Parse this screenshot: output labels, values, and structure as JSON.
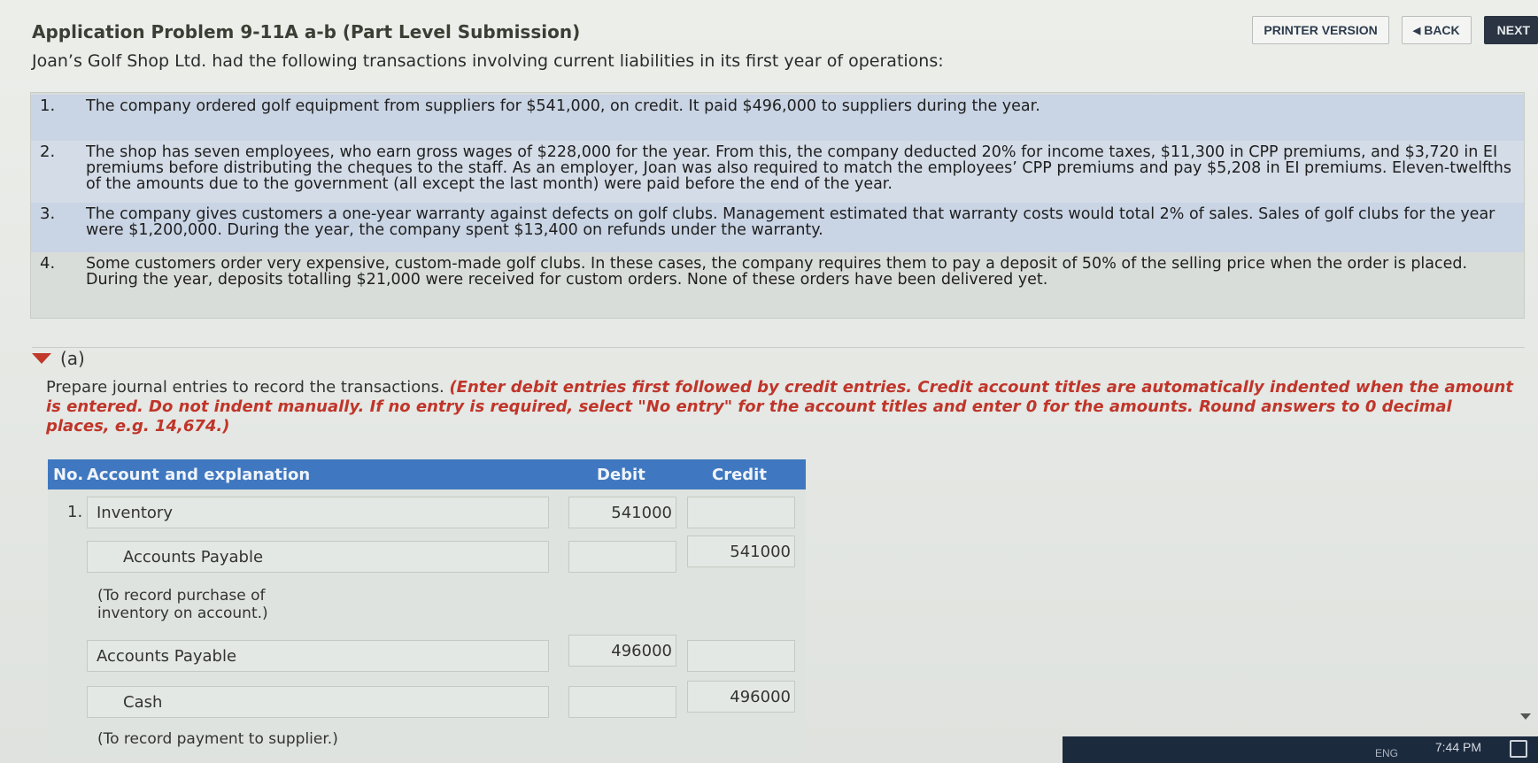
{
  "nav": {
    "printer_version": "PRINTER VERSION",
    "back": "BACK",
    "next": "NEXT"
  },
  "problem": {
    "title": "Application Problem 9-11A a-b (Part Level Submission)",
    "intro": "Joan’s Golf Shop Ltd. had the following transactions involving current liabilities in its first year of operations:",
    "items": [
      {
        "num": "1.",
        "text": "The company ordered golf equipment from suppliers for $541,000, on credit. It paid $496,000 to suppliers during the year."
      },
      {
        "num": "2.",
        "text": "The shop has seven employees, who earn gross wages of $228,000 for the year. From this, the company deducted 20% for income taxes, $11,300 in CPP premiums, and $3,720 in EI premiums before distributing the cheques to the staff. As an employer, Joan was also required to match the employees’ CPP premiums and pay $5,208 in EI premiums. Eleven-twelfths of the amounts due to the government (all except the last month) were paid before the end of the year."
      },
      {
        "num": "3.",
        "text": "The company gives customers a one-year warranty against defects on golf clubs. Management estimated that warranty costs would total 2% of sales. Sales of golf clubs for the year were $1,200,000. During the year, the company spent $13,400 on refunds under the warranty."
      },
      {
        "num": "4.",
        "text": "Some customers order very expensive, custom-made golf clubs. In these cases, the company requires them to pay a deposit of 50% of the selling price when the order is placed. During the year, deposits totalling $21,000 were received for custom orders. None of these orders have been delivered yet."
      }
    ]
  },
  "part_a": {
    "label": "(a)",
    "instruction_lead": "Prepare journal entries to record the transactions. ",
    "instruction_red": "(Enter debit entries first followed by credit entries. Credit account titles are automatically indented when the amount is entered. Do not indent manually. If no entry is required, select \"No entry\" for the account titles and enter 0 for the amounts. Round answers to 0 decimal places, e.g. 14,674.)",
    "table": {
      "headers": {
        "no": "No.",
        "account": "Account and explanation",
        "debit": "Debit",
        "credit": "Credit"
      },
      "entry_no": "1.",
      "rows": [
        {
          "account": "Inventory",
          "debit": "541000",
          "credit": ""
        },
        {
          "account": "Accounts Payable",
          "debit": "",
          "credit": "541000"
        },
        {
          "account": "Accounts Payable",
          "debit": "496000",
          "credit": ""
        },
        {
          "account": "Cash",
          "debit": "",
          "credit": "496000"
        }
      ],
      "notes": [
        "(To record purchase of inventory on account.)",
        "(To record payment to supplier.)"
      ]
    }
  },
  "taskbar": {
    "lang": "ENG",
    "time": "7:44 PM"
  }
}
